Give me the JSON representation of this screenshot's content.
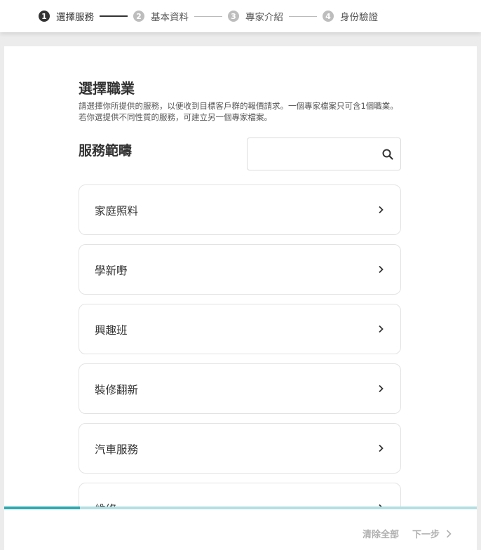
{
  "stepper": {
    "steps": [
      {
        "num": "1",
        "label": "選擇服務"
      },
      {
        "num": "2",
        "label": "基本資料"
      },
      {
        "num": "3",
        "label": "專家介紹"
      },
      {
        "num": "4",
        "label": "身份驗證"
      }
    ]
  },
  "main": {
    "title": "選擇職業",
    "description": "請選擇你所提供的服務，以便收到目標客戶群的報價請求。一個專家檔案只可含1個職業。若你選提供不同性質的服務，可建立另一個專家檔案。",
    "section_title": "服務範疇",
    "search": {
      "placeholder": "",
      "value": "",
      "icon": "search-icon"
    },
    "categories": [
      {
        "label": "家庭照料"
      },
      {
        "label": "學新嘢"
      },
      {
        "label": "興趣班"
      },
      {
        "label": "裝修翻新"
      },
      {
        "label": "汽車服務"
      },
      {
        "label": "維修"
      }
    ]
  },
  "progress": {
    "fraction": 0.16,
    "fill_color": "#2eaab0",
    "track_color": "#b3dfe3"
  },
  "footer": {
    "clear_label": "清除全部",
    "next_label": "下一步"
  }
}
